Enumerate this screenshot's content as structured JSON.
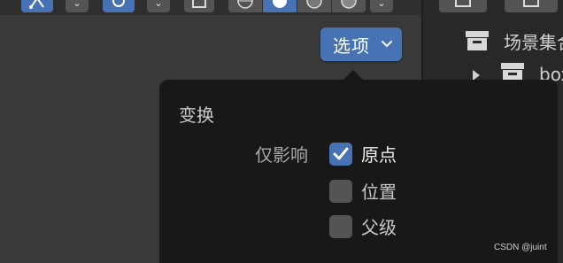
{
  "options_button": {
    "label": "选项"
  },
  "popover": {
    "section_title": "变换",
    "affect_only_label": "仅影响",
    "options": [
      {
        "label": "原点",
        "checked": true
      },
      {
        "label": "位置",
        "checked": false
      },
      {
        "label": "父级",
        "checked": false
      }
    ]
  },
  "outliner": {
    "scene_collection_label": "场景集合",
    "child_label": "box"
  },
  "watermark": "CSDN @juint",
  "colors": {
    "accent": "#4772b3",
    "popover_bg": "#181818",
    "viewport_bg": "#393939"
  }
}
